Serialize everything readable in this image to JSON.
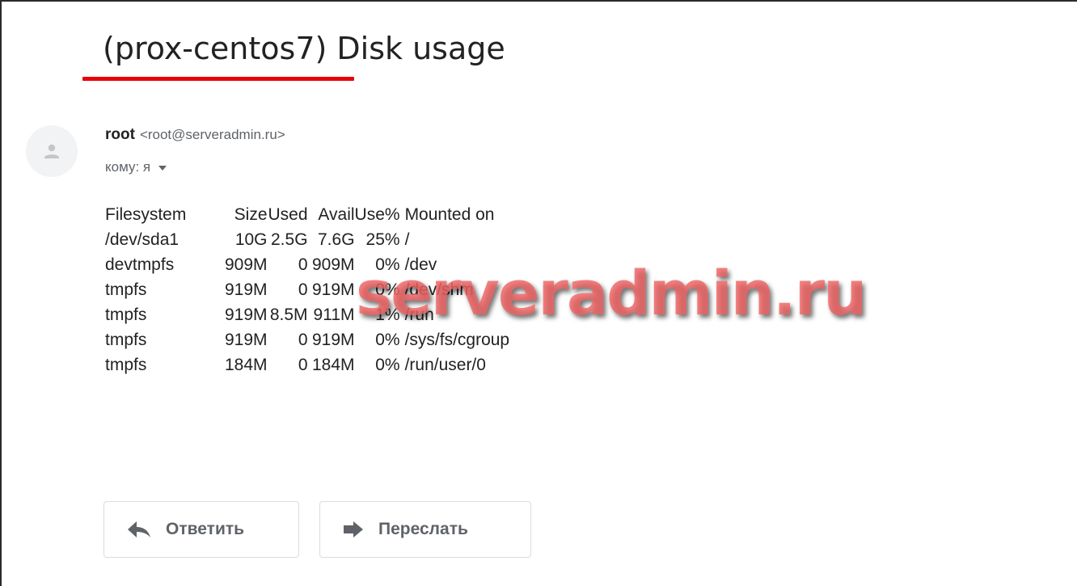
{
  "email": {
    "subject": "(prox-centos7) Disk usage",
    "sender_name": "root",
    "sender_address": "<root@serveradmin.ru>",
    "recipient": "кому: я",
    "df_header": [
      "Filesystem",
      "Size",
      "Used",
      "Avail",
      "Use%",
      "Mounted on"
    ],
    "df_rows": [
      [
        "/dev/sda1",
        "10G",
        "2.5G",
        "7.6G",
        "25%",
        "/"
      ],
      [
        "devtmpfs",
        "909M",
        "0",
        "909M",
        "0%",
        "/dev"
      ],
      [
        "tmpfs",
        "919M",
        "0",
        "919M",
        "0%",
        "/dev/shm"
      ],
      [
        "tmpfs",
        "919M",
        "8.5M",
        "911M",
        "1%",
        "/run"
      ],
      [
        "tmpfs",
        "919M",
        "0",
        "919M",
        "0%",
        "/sys/fs/cgroup"
      ],
      [
        "tmpfs",
        "184M",
        "0",
        "184M",
        "0%",
        "/run/user/0"
      ]
    ]
  },
  "actions": {
    "reply_label": "Ответить",
    "forward_label": "Переслать"
  },
  "watermark": "serveradmin.ru",
  "colors": {
    "underline": "#e8000b",
    "watermark": "#f06464"
  },
  "icons": {
    "avatar": "person-icon",
    "recipient_toggle": "caret-down-icon",
    "reply": "reply-arrow-icon",
    "forward": "forward-arrow-icon"
  }
}
